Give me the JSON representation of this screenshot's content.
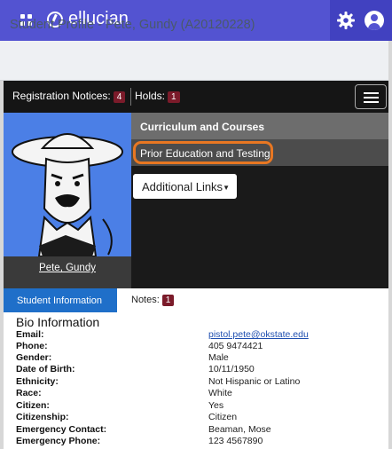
{
  "header": {
    "brand": "ellucian",
    "icons": [
      "apps-grid-icon",
      "ellucian-logo-icon",
      "gear-icon",
      "user-icon"
    ]
  },
  "page": {
    "title": "Student Profile - Pete, Gundy (A20120228)"
  },
  "notices": {
    "registration_label": "Registration Notices:",
    "registration_count": "4",
    "holds_label": "Holds:",
    "holds_count": "1"
  },
  "profile": {
    "name": "Pete, Gundy"
  },
  "menu": {
    "curriculum": "Curriculum and Courses",
    "prior_education": "Prior Education and Testing",
    "additional_links": "Additional Links"
  },
  "tabs": {
    "student_info": "Student Information",
    "notes_label": "Notes:",
    "notes_count": "1"
  },
  "bio": {
    "heading": "Bio Information",
    "rows": [
      {
        "label": "Email:",
        "value": "pistol.pete@okstate.edu"
      },
      {
        "label": "Phone:",
        "value": "405 9474421"
      },
      {
        "label": "Gender:",
        "value": "Male"
      },
      {
        "label": "Date of Birth:",
        "value": "10/11/1950"
      },
      {
        "label": "Ethnicity:",
        "value": "Not Hispanic or Latino"
      },
      {
        "label": "Race:",
        "value": "White"
      },
      {
        "label": "Citizen:",
        "value": "Yes"
      },
      {
        "label": "Citizenship:",
        "value": "Citizen"
      },
      {
        "label": "Emergency Contact:",
        "value": "Beaman, Mose"
      },
      {
        "label": "Emergency Phone:",
        "value": "123 4567890"
      }
    ]
  },
  "colors": {
    "header": "#5353d1",
    "highlight_outline": "#e87722",
    "active_tab": "#1f6fc9",
    "badge": "#7b1b2a"
  }
}
